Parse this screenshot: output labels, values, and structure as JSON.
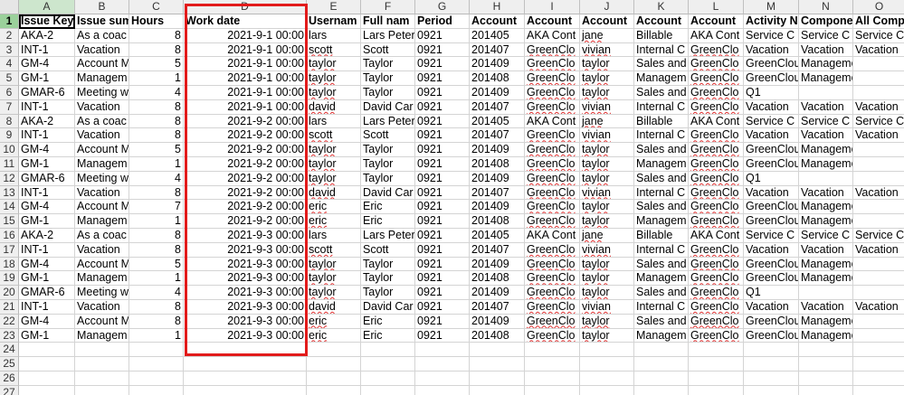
{
  "columns": [
    "A",
    "B",
    "C",
    "D",
    "E",
    "F",
    "G",
    "H",
    "I",
    "J",
    "K",
    "L",
    "M",
    "N",
    "O"
  ],
  "selected_column": "A",
  "highlighted_column": "D",
  "highlight_color": "#e21b1b",
  "rows": [
    {
      "n": "1",
      "cells": [
        "Issue Key",
        "Issue sum",
        "Hours",
        "Work date",
        "Usernam",
        "Full nam",
        "Period",
        "Account",
        "Account",
        "Account",
        "Account",
        "Account",
        "Activity N",
        "Compone",
        "All Comp"
      ]
    },
    {
      "n": "2",
      "cells": [
        "AKA-2",
        "As a coac",
        "8",
        "2021-9-1 00:00",
        "lars",
        "Lars Peter",
        "0921",
        "201405",
        "AKA Cont",
        "jane",
        "Billable",
        "AKA Cont",
        "Service C",
        "Service C",
        "Service C"
      ]
    },
    {
      "n": "3",
      "cells": [
        "INT-1",
        "Vacation",
        "8",
        "2021-9-1 00:00",
        "scott",
        "Scott",
        "0921",
        "201407",
        "GreenClo",
        "vivian",
        "Internal C",
        "GreenClo",
        "Vacation",
        "Vacation",
        "Vacation"
      ]
    },
    {
      "n": "4",
      "cells": [
        "GM-4",
        "Account M",
        "5",
        "2021-9-1 00:00",
        "taylor",
        "Taylor",
        "0921",
        "201409",
        "GreenClo",
        "taylor",
        "Sales and",
        "GreenClo",
        "GreenCloud",
        "Management",
        ""
      ]
    },
    {
      "n": "5",
      "cells": [
        "GM-1",
        "Managem",
        "1",
        "2021-9-1 00:00",
        "taylor",
        "Taylor",
        "0921",
        "201408",
        "GreenClo",
        "taylor",
        "Managem",
        "GreenClo",
        "GreenCloud",
        "Management",
        ""
      ]
    },
    {
      "n": "6",
      "cells": [
        "GMAR-6",
        "Meeting w",
        "4",
        "2021-9-1 00:00",
        "taylor",
        "Taylor",
        "0921",
        "201409",
        "GreenClo",
        "taylor",
        "Sales and",
        "GreenClo",
        "Q1",
        "",
        ""
      ]
    },
    {
      "n": "7",
      "cells": [
        "INT-1",
        "Vacation",
        "8",
        "2021-9-1 00:00",
        "david",
        "David Car",
        "0921",
        "201407",
        "GreenClo",
        "vivian",
        "Internal C",
        "GreenClo",
        "Vacation",
        "Vacation",
        "Vacation"
      ]
    },
    {
      "n": "8",
      "cells": [
        "AKA-2",
        "As a coac",
        "8",
        "2021-9-2 00:00",
        "lars",
        "Lars Peter",
        "0921",
        "201405",
        "AKA Cont",
        "jane",
        "Billable",
        "AKA Cont",
        "Service C",
        "Service C",
        "Service C"
      ]
    },
    {
      "n": "9",
      "cells": [
        "INT-1",
        "Vacation",
        "8",
        "2021-9-2 00:00",
        "scott",
        "Scott",
        "0921",
        "201407",
        "GreenClo",
        "vivian",
        "Internal C",
        "GreenClo",
        "Vacation",
        "Vacation",
        "Vacation"
      ]
    },
    {
      "n": "10",
      "cells": [
        "GM-4",
        "Account M",
        "5",
        "2021-9-2 00:00",
        "taylor",
        "Taylor",
        "0921",
        "201409",
        "GreenClo",
        "taylor",
        "Sales and",
        "GreenClo",
        "GreenCloud",
        "Management",
        ""
      ]
    },
    {
      "n": "11",
      "cells": [
        "GM-1",
        "Managem",
        "1",
        "2021-9-2 00:00",
        "taylor",
        "Taylor",
        "0921",
        "201408",
        "GreenClo",
        "taylor",
        "Managem",
        "GreenClo",
        "GreenCloud",
        "Management",
        ""
      ]
    },
    {
      "n": "12",
      "cells": [
        "GMAR-6",
        "Meeting w",
        "4",
        "2021-9-2 00:00",
        "taylor",
        "Taylor",
        "0921",
        "201409",
        "GreenClo",
        "taylor",
        "Sales and",
        "GreenClo",
        "Q1",
        "",
        ""
      ]
    },
    {
      "n": "13",
      "cells": [
        "INT-1",
        "Vacation",
        "8",
        "2021-9-2 00:00",
        "david",
        "David Car",
        "0921",
        "201407",
        "GreenClo",
        "vivian",
        "Internal C",
        "GreenClo",
        "Vacation",
        "Vacation",
        "Vacation"
      ]
    },
    {
      "n": "14",
      "cells": [
        "GM-4",
        "Account M",
        "7",
        "2021-9-2 00:00",
        "eric",
        "Eric",
        "0921",
        "201409",
        "GreenClo",
        "taylor",
        "Sales and",
        "GreenClo",
        "GreenCloud",
        "Management",
        ""
      ]
    },
    {
      "n": "15",
      "cells": [
        "GM-1",
        "Managem",
        "1",
        "2021-9-2 00:00",
        "eric",
        "Eric",
        "0921",
        "201408",
        "GreenClo",
        "taylor",
        "Managem",
        "GreenClo",
        "GreenCloud",
        "Management",
        ""
      ]
    },
    {
      "n": "16",
      "cells": [
        "AKA-2",
        "As a coac",
        "8",
        "2021-9-3 00:00",
        "lars",
        "Lars Peter",
        "0921",
        "201405",
        "AKA Cont",
        "jane",
        "Billable",
        "AKA Cont",
        "Service C",
        "Service C",
        "Service C"
      ]
    },
    {
      "n": "17",
      "cells": [
        "INT-1",
        "Vacation",
        "8",
        "2021-9-3 00:00",
        "scott",
        "Scott",
        "0921",
        "201407",
        "GreenClo",
        "vivian",
        "Internal C",
        "GreenClo",
        "Vacation",
        "Vacation",
        "Vacation"
      ]
    },
    {
      "n": "18",
      "cells": [
        "GM-4",
        "Account M",
        "5",
        "2021-9-3 00:00",
        "taylor",
        "Taylor",
        "0921",
        "201409",
        "GreenClo",
        "taylor",
        "Sales and",
        "GreenClo",
        "GreenCloud",
        "Management",
        ""
      ]
    },
    {
      "n": "19",
      "cells": [
        "GM-1",
        "Managem",
        "1",
        "2021-9-3 00:00",
        "taylor",
        "Taylor",
        "0921",
        "201408",
        "GreenClo",
        "taylor",
        "Managem",
        "GreenClo",
        "GreenCloud",
        "Management",
        ""
      ]
    },
    {
      "n": "20",
      "cells": [
        "GMAR-6",
        "Meeting w",
        "4",
        "2021-9-3 00:00",
        "taylor",
        "Taylor",
        "0921",
        "201409",
        "GreenClo",
        "taylor",
        "Sales and",
        "GreenClo",
        "Q1",
        "",
        ""
      ]
    },
    {
      "n": "21",
      "cells": [
        "INT-1",
        "Vacation",
        "8",
        "2021-9-3 00:00",
        "david",
        "David Car",
        "0921",
        "201407",
        "GreenClo",
        "vivian",
        "Internal C",
        "GreenClo",
        "Vacation",
        "Vacation",
        "Vacation"
      ]
    },
    {
      "n": "22",
      "cells": [
        "GM-4",
        "Account M",
        "8",
        "2021-9-3 00:00",
        "eric",
        "Eric",
        "0921",
        "201409",
        "GreenClo",
        "taylor",
        "Sales and",
        "GreenClo",
        "GreenCloud",
        "Management",
        ""
      ]
    },
    {
      "n": "23",
      "cells": [
        "GM-1",
        "Managem",
        "1",
        "2021-9-3 00:00",
        "eric",
        "Eric",
        "0921",
        "201408",
        "GreenClo",
        "taylor",
        "Managem",
        "GreenClo",
        "GreenCloud",
        "Management",
        ""
      ]
    },
    {
      "n": "24",
      "cells": [
        "",
        "",
        "",
        "",
        "",
        "",
        "",
        "",
        "",
        "",
        "",
        "",
        "",
        "",
        ""
      ]
    },
    {
      "n": "25",
      "cells": [
        "",
        "",
        "",
        "",
        "",
        "",
        "",
        "",
        "",
        "",
        "",
        "",
        "",
        "",
        ""
      ]
    },
    {
      "n": "26",
      "cells": [
        "",
        "",
        "",
        "",
        "",
        "",
        "",
        "",
        "",
        "",
        "",
        "",
        "",
        "",
        ""
      ]
    },
    {
      "n": "27",
      "cells": [
        "",
        "",
        "",
        "",
        "",
        "",
        "",
        "",
        "",
        "",
        "",
        "",
        "",
        "",
        ""
      ]
    }
  ]
}
